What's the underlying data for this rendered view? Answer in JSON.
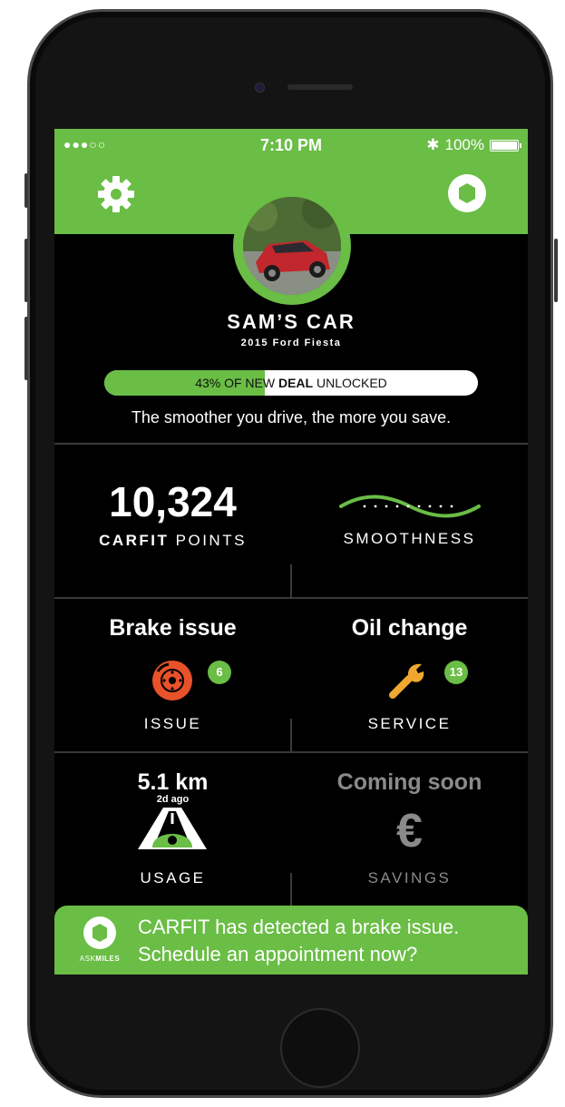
{
  "status_bar": {
    "signal": "●●●○○",
    "time": "7:10 PM",
    "bluetooth": "✱",
    "battery": "100%"
  },
  "header": {
    "settings_icon": "gear-icon",
    "app_icon": "askmiles-logo-icon"
  },
  "car": {
    "name": "SAM’S CAR",
    "model": "2015 Ford Fiesta"
  },
  "deal": {
    "prefix": "43% OF NEW ",
    "bold": "DEAL",
    "suffix": " UNLOCKED",
    "percent": 43
  },
  "tagline": "The smoother you drive, the more you save.",
  "points": {
    "value": "10,324",
    "label_bold": "CARFIT",
    "label_rest": " POINTS"
  },
  "smoothness": {
    "label": "SMOOTHNESS"
  },
  "brake": {
    "title": "Brake issue",
    "count": "6",
    "label": "ISSUE"
  },
  "oil": {
    "title": "Oil change",
    "count": "13",
    "label": "SERVICE"
  },
  "usage": {
    "value": "5.1 km",
    "ago": "2d ago",
    "label": "USAGE"
  },
  "savings": {
    "title": "Coming soon",
    "symbol": "€",
    "label": "SAVINGS"
  },
  "banner": {
    "line1": "CARFIT has detected a brake issue.",
    "line2": "Schedule an appointment now?",
    "logo_text_a": "ASK",
    "logo_text_b": "MILES"
  },
  "colors": {
    "accent": "#6abd45",
    "issue": "#e8522a",
    "service": "#f0a830",
    "muted": "#8a8a8a"
  }
}
